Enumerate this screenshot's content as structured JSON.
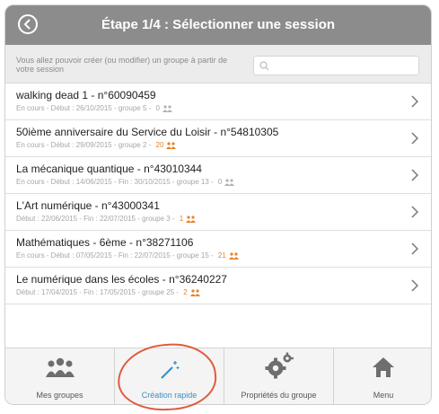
{
  "header": {
    "title": "Étape 1/4 : Sélectionner une session"
  },
  "subheader": {
    "text": "Vous allez pouvoir créer (ou modifier) un groupe à partir de votre session",
    "search_placeholder": ""
  },
  "sessions": [
    {
      "title": "walking dead 1 - n°60090459",
      "sub": "En cours - Début : 26/10/2015 - groupe 5 - ",
      "count": "0",
      "highlight": false
    },
    {
      "title": "50ième anniversaire du Service du Loisir - n°54810305",
      "sub": "En cours - Début : 29/09/2015 - groupe 2 - ",
      "count": "20",
      "highlight": true
    },
    {
      "title": "La mécanique quantique - n°43010344",
      "sub": "En cours - Début : 14/06/2015 - Fin : 30/10/2015 - groupe 13 - ",
      "count": "0",
      "highlight": false
    },
    {
      "title": "L'Art numérique - n°43000341",
      "sub": "Début : 22/06/2015 - Fin : 22/07/2015 - groupe 3 - ",
      "count": "1",
      "highlight": true
    },
    {
      "title": "Mathématiques - 6ème - n°38271106",
      "sub": "En cours - Début : 07/05/2015 - Fin : 22/07/2015 - groupe 15 - ",
      "count": "21",
      "highlight": true
    },
    {
      "title": "Le numérique dans les écoles - n°36240227",
      "sub": "Début : 17/04/2015 - Fin : 17/05/2015 - groupe 25 - ",
      "count": "2",
      "highlight": true
    }
  ],
  "tabs": [
    {
      "label": "Mes groupes",
      "icon": "groups-icon"
    },
    {
      "label": "Création rapide",
      "icon": "magic-wand-icon"
    },
    {
      "label": "Propriétés du groupe",
      "icon": "gears-icon"
    },
    {
      "label": "Menu",
      "icon": "home-icon"
    }
  ],
  "colors": {
    "accent": "#3a8fc7",
    "highlight": "#e8822a",
    "header": "#8c8c8c",
    "annotation": "#e15a3e"
  }
}
